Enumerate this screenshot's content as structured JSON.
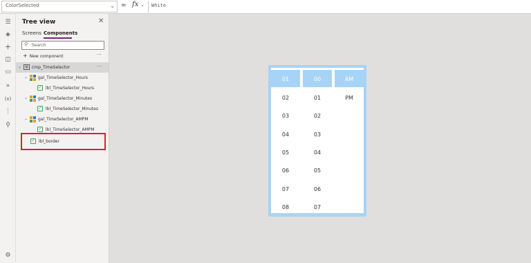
{
  "formula_bar": {
    "property": "ColorSelected",
    "equals": "=",
    "fx_label": "fx",
    "formula": "White"
  },
  "tree_view": {
    "title": "Tree view",
    "tabs": [
      "Screens",
      "Components"
    ],
    "active_tab": "Components",
    "search_placeholder": "Search",
    "new_component_label": "New component",
    "nodes": [
      {
        "label": "cmp_TimeSelector"
      },
      {
        "label": "gal_TimeSelector_Hours"
      },
      {
        "label": "lbl_TimeSelector_Hours"
      },
      {
        "label": "gal_TimeSelector_Minutes"
      },
      {
        "label": "lbl_TimeSelector_Minutes"
      },
      {
        "label": "gal_TimeSelector_AMPM"
      },
      {
        "label": "lbl_TimeSelector_AMPM"
      },
      {
        "label": "lbl_border"
      }
    ]
  },
  "time_selector": {
    "selected": {
      "hour": "01",
      "minute": "00",
      "ampm": "AM"
    },
    "hours": [
      "02",
      "03",
      "04",
      "05",
      "06",
      "07",
      "08"
    ],
    "minutes": [
      "01",
      "02",
      "03",
      "04",
      "05",
      "06",
      "07"
    ],
    "ampm": [
      "PM"
    ],
    "accent_color": "#a7d4f6"
  },
  "rail_icons": [
    "hamburger-icon",
    "layers-icon",
    "plus-icon",
    "database-icon",
    "media-icon",
    "flow-icon",
    "variables-icon",
    "tools-icon",
    "search-icon",
    "settings-icon"
  ]
}
